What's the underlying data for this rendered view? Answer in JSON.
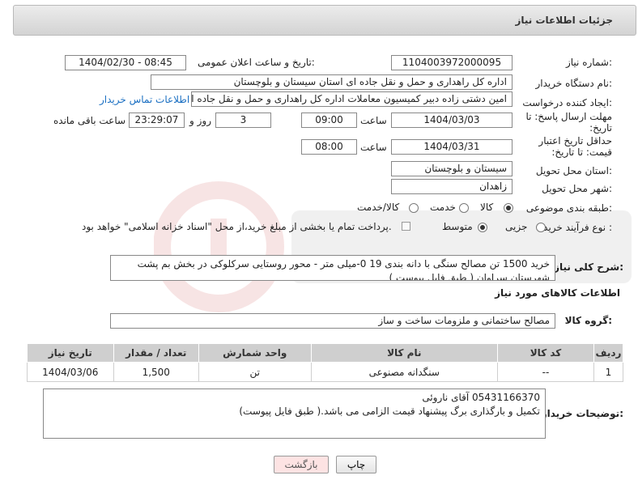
{
  "header": {
    "title": "جزئیات اطلاعات نیاز"
  },
  "fields": {
    "need_number_label": "شماره نیاز:",
    "need_number": "1104003972000095",
    "announce_label": "تاریخ و ساعت اعلان عمومی:",
    "announce_value": "1404/02/30 - 08:45",
    "buyer_org_label": "نام دستگاه خریدار:",
    "buyer_org": "اداره کل راهداری و حمل و نقل جاده ای استان سیستان و بلوچستان",
    "creator_label": "ایجاد کننده درخواست:",
    "creator": "امین دشتی زاده دبیر کمیسیون معاملات اداره کل راهداری و حمل و نقل جاده ای",
    "contact_link": "اطلاعات تماس خریدار",
    "deadline_label": "مهلت ارسال پاسخ: تا تاریخ:",
    "deadline_date": "1404/03/03",
    "time_label": "ساعت",
    "deadline_time": "09:00",
    "days_value": "3",
    "days_label": "روز و",
    "remaining_time": "23:29:07",
    "remaining_label": "ساعت باقی مانده",
    "validity_label": "حداقل تاریخ اعتبار قیمت: تا تاریخ:",
    "validity_date": "1404/03/31",
    "validity_time": "08:00",
    "province_label": "استان محل تحویل:",
    "province": "سیستان و بلوچستان",
    "city_label": "شهر محل تحویل:",
    "city": "زاهدان",
    "category_label": "طبقه بندی موضوعی:",
    "category_options": [
      "کالا",
      "خدمت",
      "کالا/خدمت"
    ],
    "process_label": "نوع فرآیند خرید :",
    "process_options": [
      "جزیی",
      "متوسط"
    ],
    "payment_note": "پرداخت تمام یا بخشی از مبلغ خرید،از محل \"اسناد خزانه اسلامی\" خواهد بود."
  },
  "description": {
    "label": "شرح کلی نیاز:",
    "text": "خرید 1500 تن مصالح سنگی با دانه بندی 19 0-میلی متر - محور روستایی سرکلوکی در بخش بم پشت شهرستان سراوان    ( طبق فایل پیوست )"
  },
  "goods": {
    "section_title": "اطلاعات کالاهای مورد نیاز",
    "group_label": "گروه کالا:",
    "group_value": "مصالح ساختمانی و ملزومات ساخت و ساز",
    "columns": [
      "ردیف",
      "کد کالا",
      "نام کالا",
      "واحد شمارش",
      "تعداد / مقدار",
      "تاریخ نیاز"
    ],
    "rows": [
      {
        "row": "1",
        "code": "--",
        "name": "سنگدانه مصنوعی",
        "unit": "تن",
        "qty": "1,500",
        "date": "1404/03/06"
      }
    ]
  },
  "buyer_notes": {
    "label": "توضیحات خریدار:",
    "line1": "05431166370 آقای ناروئی",
    "line2": "تکمیل و بارگذاری برگ پیشنهاد قیمت الزامی می باشد.( طبق فایل پیوست)"
  },
  "buttons": {
    "print": "چاپ",
    "back": "بازگشت"
  },
  "colors": {
    "link": "#1a6fc2",
    "back_button_bg": "#fde3e3",
    "table_header_bg": "#cfcfcf"
  }
}
